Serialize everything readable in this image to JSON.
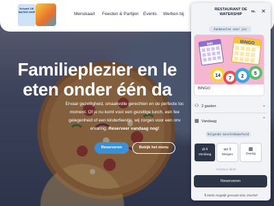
{
  "brand": {
    "logo_text": "Eetcafé DE WATER SHIP"
  },
  "nav": {
    "items": [
      "Menukaart",
      "Feesten & Partijen",
      "Events",
      "Werken bij"
    ]
  },
  "hero": {
    "title_line1": "Familieplezier en le",
    "title_line2": "eten onder één da",
    "text_line1": "Ervaar gezelligheid, smaakvolle gerechten en de perfecte loc",
    "text_line2": "moment. Of je nu komt voor een gezellige lunch, een fee",
    "text_line3": "gelegenheid of een kinderfeestje, wij zorgen voor een onv",
    "text_line4_plain": "ervaring. ",
    "text_line4_bold": "Reserveer vandaag nog!",
    "reserve_button": "Reserveren",
    "menu_button": "Bekijk het menu"
  },
  "widget": {
    "title_line1": "RESTAURANT DE",
    "title_line2": "WATERSHIP",
    "language": "NL",
    "chip": "Aanbevolen voor jou",
    "card_label": "BINGO",
    "bingo_word": "BINGO",
    "bingo_small": "BIN",
    "ball_numbers": [
      "14",
      "7",
      "2",
      "5"
    ],
    "guests": "2 gasten",
    "date_label": "Vandaag",
    "availability_chip": "Volgende beschikbaarheid",
    "days": [
      {
        "line1": "di 4",
        "line2": "Vandaag",
        "selected": true
      },
      {
        "line1": "wo 5",
        "line2": "Morgen",
        "selected": false
      },
      {
        "line2": "Overig",
        "selected": false
      }
    ],
    "faded_text": "Avontuur diner",
    "submit": "Reserveren",
    "powered": "Mede mogelijk gemaakt door Zenchef"
  },
  "colors": {
    "accent_blue": "#3b8fd4",
    "widget_dark": "#2c3646",
    "chip_bg": "#dde5ef"
  },
  "icons": {
    "close": "close-icon",
    "guests": "people-icon",
    "date": "calendar-icon",
    "other_day": "calendar-icon",
    "zenchef": "zenchef-logo-icon"
  }
}
